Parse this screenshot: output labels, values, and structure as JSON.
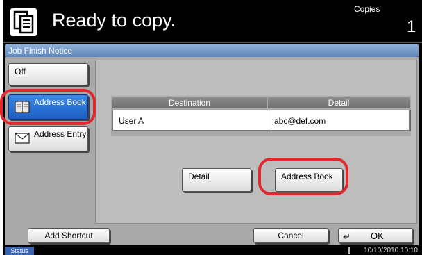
{
  "header": {
    "title": "Ready to copy.",
    "copies_label": "Copies",
    "copies_value": "1",
    "icon": "copy-document-icon"
  },
  "panel": {
    "title": "Job Finish Notice"
  },
  "sidebar": {
    "off_label": "Off",
    "address_book_label": "Address Book",
    "address_entry_label": "Address Entry",
    "address_book_icon": "book-icon",
    "address_entry_icon": "envelope-icon"
  },
  "table": {
    "headers": [
      "Destination",
      "Detail"
    ],
    "rows": [
      {
        "destination": "User A",
        "detail": "abc@def.com"
      }
    ]
  },
  "actions": {
    "detail_label": "Detail",
    "address_book_label": "Address Book"
  },
  "footer": {
    "add_shortcut_label": "Add Shortcut",
    "cancel_label": "Cancel",
    "ok_label": "OK",
    "ok_icon": "enter-arrow-icon"
  },
  "status": {
    "label": "Status",
    "datetime": "10/10/2010 10:10"
  },
  "colors": {
    "accent_blue": "#1e5ec4",
    "highlight_red": "#e0282e",
    "panel_gray": "#a9a9a9"
  }
}
